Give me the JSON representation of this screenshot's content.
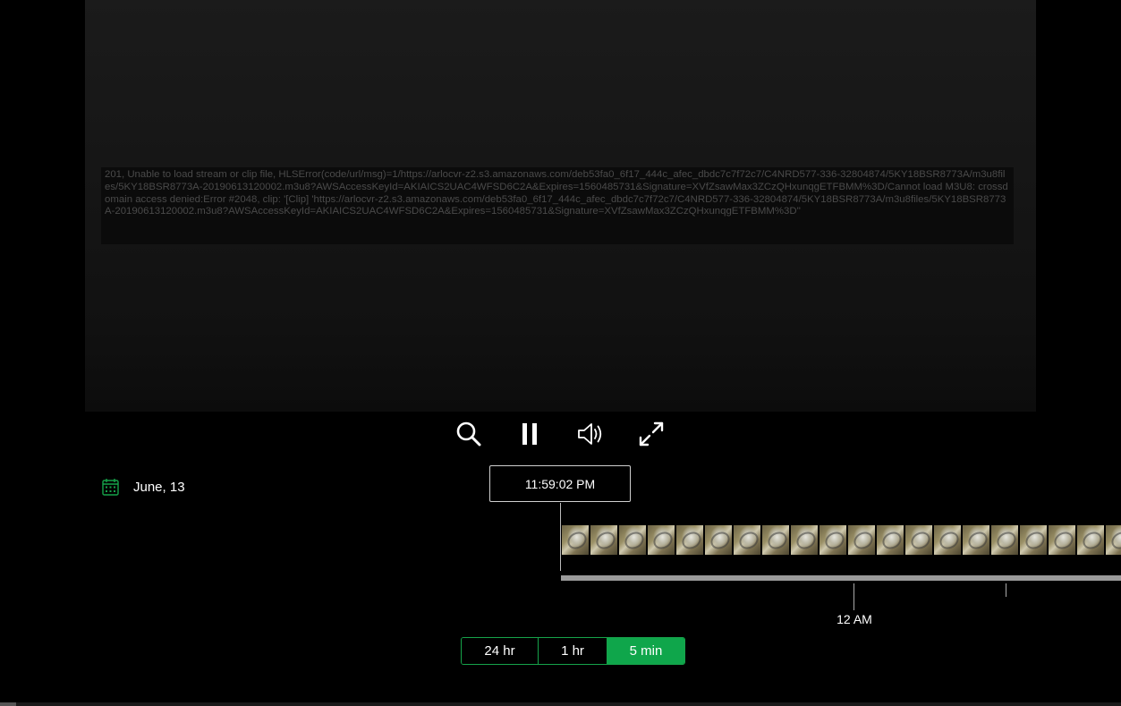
{
  "player": {
    "error_message": "201, Unable to load stream or clip file, HLSError(code/url/msg)=1/https://arlocvr-z2.s3.amazonaws.com/deb53fa0_6f17_444c_afec_dbdc7c7f72c7/C4NRD577-336-32804874/5KY18BSR8773A/m3u8files/5KY18BSR8773A-20190613120002.m3u8?AWSAccessKeyId=AKIAICS2UAC4WFSD6C2A&Expires=1560485731&Signature=XVfZsawMax3ZCzQHxunqgETFBMM%3D/Cannot load M3U8: crossdomain access denied:Error #2048, clip: '[Clip] 'https://arlocvr-z2.s3.amazonaws.com/deb53fa0_6f17_444c_afec_dbdc7c7f72c7/C4NRD577-336-32804874/5KY18BSR8773A/m3u8files/5KY18BSR8773A-20190613120002.m3u8?AWSAccessKeyId=AKIAICS2UAC4WFSD6C2A&Expires=1560485731&Signature=XVfZsawMax3ZCzQHxunqgETFBMM%3D''"
  },
  "controls": {
    "icons": [
      "search-icon",
      "pause-icon",
      "volume-icon",
      "fullscreen-icon"
    ]
  },
  "date": {
    "icon": "calendar-icon",
    "label": "June, 13"
  },
  "timeline": {
    "current_time": "11:59:02 PM",
    "tick_label": "12 AM",
    "thumbnail_count": 20
  },
  "range_selector": {
    "options": [
      "24 hr",
      "1 hr",
      "5 min"
    ],
    "selected": "5 min"
  },
  "colors": {
    "accent": "#0fa64b",
    "accent_border": "#16a34a",
    "background": "#000000"
  }
}
